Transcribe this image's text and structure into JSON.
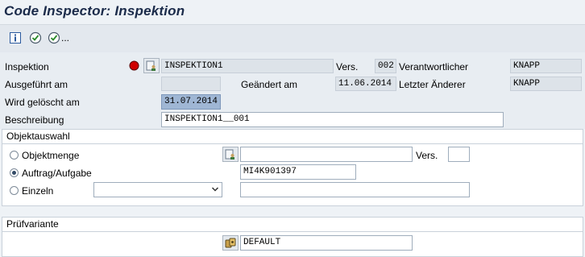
{
  "window": {
    "title": "Code Inspector: Inspektion"
  },
  "toolbar": {
    "more": "..."
  },
  "header": {
    "inspektion_label": "Inspektion",
    "inspektion_value": "INSPEKTION1",
    "vers_label": "Vers.",
    "vers_value": "002",
    "verantwortlicher_label": "Verantwortlicher",
    "verantwortlicher_value": "KNAPP",
    "ausgefuehrt_label": "Ausgeführt am",
    "ausgefuehrt_value": "",
    "geaendert_label": "Geändert am",
    "geaendert_value": "11.06.2014",
    "letzter_label": "Letzter Änderer",
    "letzter_value": "KNAPP",
    "geloescht_label": "Wird gelöscht am",
    "geloescht_value": "31.07.2014",
    "beschreibung_label": "Beschreibung",
    "beschreibung_value": "INSPEKTION1__001"
  },
  "objektauswahl": {
    "title": "Objektauswahl",
    "objektmenge_label": "Objektmenge",
    "objektmenge_value": "",
    "vers_label": "Vers.",
    "vers_value": "",
    "auftrag_label": "Auftrag/Aufgabe",
    "auftrag_value": "MI4K901397",
    "einzeln_label": "Einzeln",
    "einzeln_select": "",
    "einzeln_value": "",
    "selected": "auftrag"
  },
  "pruefvariante": {
    "title": "Prüfvariante",
    "value": "DEFAULT"
  },
  "colors": {
    "title": "#1b2b4a",
    "status_red": "#d00000"
  }
}
